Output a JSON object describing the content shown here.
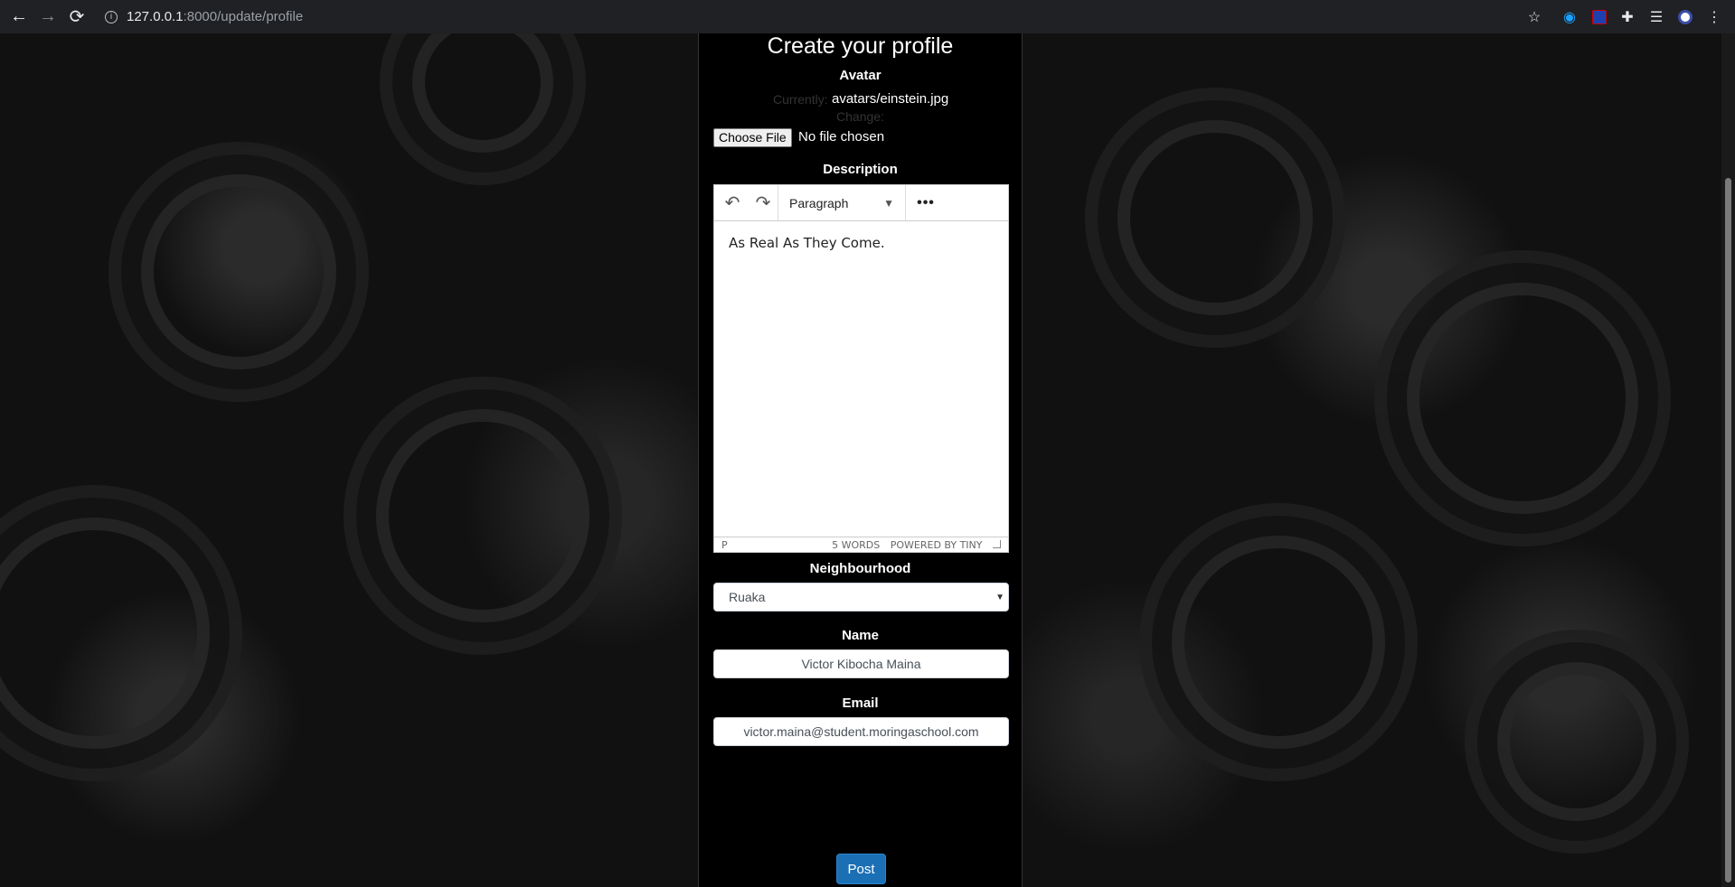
{
  "browser": {
    "url_host": "127.0.0.1",
    "url_path": ":8000/update/profile",
    "back_icon": "←",
    "forward_icon": "→",
    "reload_icon": "⟳"
  },
  "page": {
    "title": "Create your profile",
    "avatar_label": "Avatar",
    "currently_label": "Currently:",
    "current_file": "avatars/einstein.jpg",
    "change_label": "Change:",
    "file_button": "Choose File",
    "file_status": "No file chosen",
    "description_label": "Description",
    "editor": {
      "format_select": "Paragraph",
      "content": "As Real As They Come.",
      "status_path": "P",
      "word_count": "5 WORDS",
      "powered_by": "POWERED BY TINY"
    },
    "neighbourhood_label": "Neighbourhood",
    "neighbourhood_value": "Ruaka",
    "name_label": "Name",
    "name_value": "Victor Kibocha Maina",
    "email_label": "Email",
    "email_value": "victor.maina@student.moringaschool.com",
    "submit_label": "Post"
  },
  "colors": {
    "accent": "#1b6fb5",
    "panel": "#000000"
  }
}
